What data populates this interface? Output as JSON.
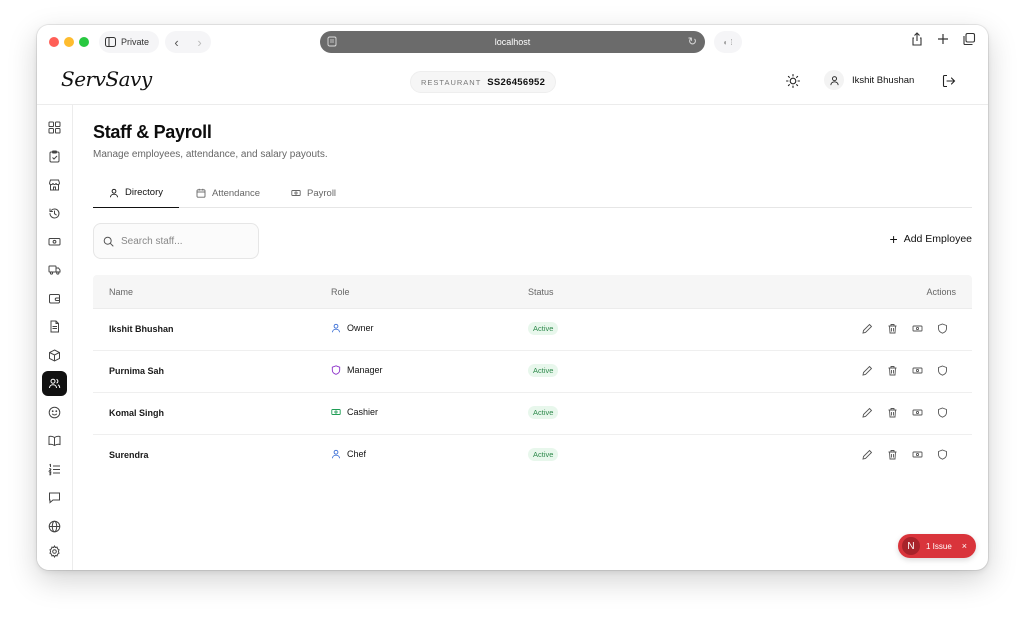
{
  "browser": {
    "private_label": "Private",
    "url": "localhost"
  },
  "header": {
    "logo": "ServSavy",
    "restaurant_label": "RESTAURANT",
    "restaurant_code": "SS26456952",
    "user_name": "Ikshit Bhushan"
  },
  "sidebar": {
    "items": [
      {
        "icon": "dashboard-icon",
        "active": false
      },
      {
        "icon": "clipboard-check-icon",
        "active": false
      },
      {
        "icon": "store-icon",
        "active": false
      },
      {
        "icon": "history-icon",
        "active": false
      },
      {
        "icon": "cash-icon",
        "active": false
      },
      {
        "icon": "truck-icon",
        "active": false
      },
      {
        "icon": "wallet-icon",
        "active": false
      },
      {
        "icon": "document-icon",
        "active": false
      },
      {
        "icon": "package-icon",
        "active": false
      },
      {
        "icon": "users-icon",
        "active": true
      },
      {
        "icon": "smile-icon",
        "active": false
      },
      {
        "icon": "book-icon",
        "active": false
      },
      {
        "icon": "list-ordered-icon",
        "active": false
      },
      {
        "icon": "message-icon",
        "active": false
      },
      {
        "icon": "globe-icon",
        "active": false
      },
      {
        "icon": "settings-icon",
        "active": false
      }
    ]
  },
  "page": {
    "title": "Staff & Payroll",
    "subtitle": "Manage employees, attendance, and salary payouts.",
    "tabs": [
      {
        "label": "Directory",
        "icon": "user-icon",
        "active": true
      },
      {
        "label": "Attendance",
        "icon": "calendar-icon",
        "active": false
      },
      {
        "label": "Payroll",
        "icon": "banknote-icon",
        "active": false
      }
    ],
    "search_placeholder": "Search staff...",
    "add_button": "Add Employee"
  },
  "table": {
    "headers": {
      "name": "Name",
      "role": "Role",
      "status": "Status",
      "actions": "Actions"
    },
    "rows": [
      {
        "name": "Ikshit Bhushan",
        "role": "Owner",
        "role_icon": "user-icon",
        "status": "Active"
      },
      {
        "name": "Purnima Sah",
        "role": "Manager",
        "role_icon": "shield-icon",
        "status": "Active"
      },
      {
        "name": "Komal Singh",
        "role": "Cashier",
        "role_icon": "banknote-icon",
        "status": "Active"
      },
      {
        "name": "Surendra",
        "role": "Chef",
        "role_icon": "user-icon",
        "status": "Active"
      }
    ]
  },
  "issue_badge": {
    "letter": "N",
    "text": "1 Issue",
    "close": "×"
  },
  "colors": {
    "accent": "#111111",
    "role_owner": "#3b6fd6",
    "role_manager": "#8b2fc9",
    "role_cashier": "#1f9d55",
    "role_chef": "#3b6fd6",
    "status_active_text": "#2f8a4c",
    "status_active_bg": "#e8f7ec",
    "issue_bg": "#d9343b"
  }
}
